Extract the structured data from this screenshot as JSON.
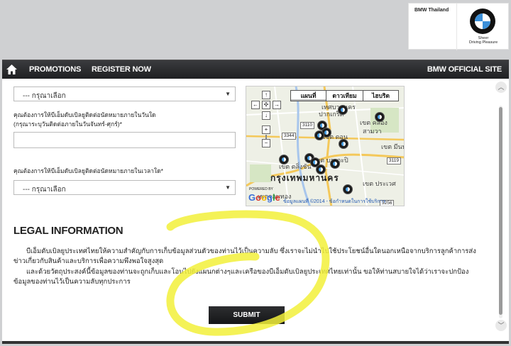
{
  "header": {
    "country": "BMW Thailand",
    "tagline_line1": "Sheer",
    "tagline_line2": "Driving Pleasure",
    "logo_colors": {
      "blue": "#3a8fd8",
      "white": "#ffffff",
      "ring": "#111111"
    }
  },
  "nav": {
    "home_icon": "home-icon",
    "promotions": "PROMOTIONS",
    "register": "REGISTER NOW",
    "official": "BMW OFFICIAL SITE"
  },
  "form": {
    "select1_value": "--- กรุณาเลือก",
    "q_day_line1": "คุณต้องการให้บีเอ็มดับเบิลยูติดต่อนัดหมายภายในวันใด",
    "q_day_line2": "(กรุณาระบุวันติดต่อภายในวันจันทร์-ศุกร์)*",
    "day_input_value": "",
    "q_time": "คุณต้องการให้บีเอ็มดับเบิลยูติดต่อนัดหมายภายในเวลาใด*",
    "select2_value": "--- กรุณาเลือก"
  },
  "map": {
    "tabs": [
      "แผนที่",
      "ดาวเทียม",
      "ไฮบริด"
    ],
    "active_tab": "แผนที่",
    "labels": {
      "l1": "เทศบาลนคร",
      "l2": "ปากเกร็ด",
      "l3": "เขต คลอง",
      "l4": "สามวา",
      "l5": "เขต ดอน",
      "l6": "เขต มีนบ",
      "l7": "เขต บางกะปิ",
      "l8": "เขต ตลิ่งชัน",
      "l9": "เขต ประเวศ",
      "l10": "เขตจอมทอง",
      "city": "กรุงเทพมหานคร"
    },
    "roads": [
      "3110",
      "3344",
      "3119",
      "3256"
    ],
    "powered_by": "POWERED BY",
    "google": "Google",
    "copyright": "ข้อมูลแผนที่ ©2014 - ข้อกำหนดในการใช้บริการ"
  },
  "legal": {
    "title": "LEGAL INFORMATION",
    "p1": "บีเอ็มดับเบิลยูประเทศไทยให้ความสำคัญกับการเก็บข้อมูลส่วนตัวของท่านไว้เป็นความลับ ซึ่งเราจะไม่นำไปใช้ประโยชน์อื่นใดนอกเหนือจากบริการลูกค้าการส่งข่าวเกี่ยวกับสินค้าและบริการเพื่อความพึงพอใจสูงสุด",
    "p2": "และด้วยวัตถุประสงค์นี้ข้อมูลของท่านจะถูกเก็บและโอนไปยังแผนกต่างๆและเครือของบีเอ็มดับเบิลยูประเทศไทยเท่านั้น ขอให้ท่านสบายใจได้ว่าเราจะปกป้องข้อมูลของท่านไว้เป็นความลับทุกประการ"
  },
  "submit_label": "SUBMIT",
  "annotation_color": "#f2f03a"
}
